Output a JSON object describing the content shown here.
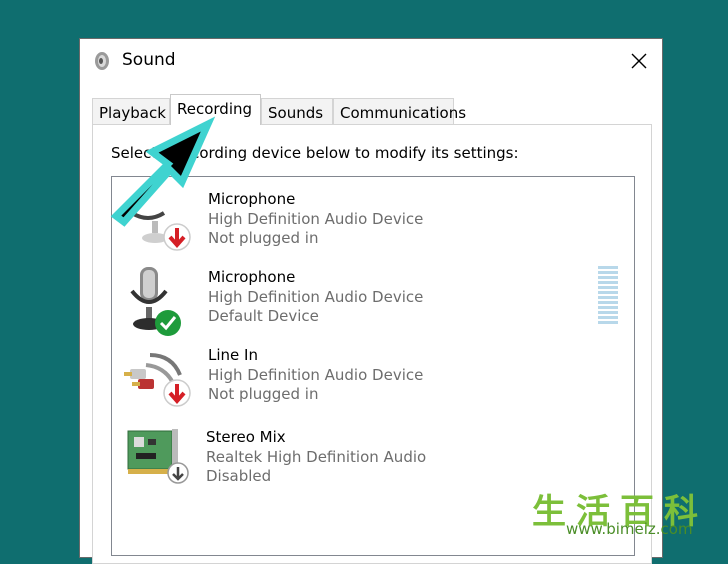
{
  "window": {
    "title": "Sound"
  },
  "tabs": [
    {
      "label": "Playback",
      "active": false
    },
    {
      "label": "Recording",
      "active": true
    },
    {
      "label": "Sounds",
      "active": false
    },
    {
      "label": "Communications",
      "active": false
    }
  ],
  "instructions": "Select a recording device below to modify its settings:",
  "devices": [
    {
      "name": "Microphone",
      "driver": "High Definition Audio Device",
      "status": "Not plugged in",
      "icon": "microphone-icon",
      "badge": "red-down-arrow-icon"
    },
    {
      "name": "Microphone",
      "driver": "High Definition Audio Device",
      "status": "Default Device",
      "icon": "microphone-icon",
      "badge": "green-check-icon"
    },
    {
      "name": "Line In",
      "driver": "High Definition Audio Device",
      "status": "Not plugged in",
      "icon": "rca-cable-icon",
      "badge": "red-down-arrow-icon"
    },
    {
      "name": "Stereo Mix",
      "driver": "Realtek High Definition Audio",
      "status": "Disabled",
      "icon": "sound-card-icon",
      "badge": "gray-down-arrow-icon"
    }
  ],
  "watermark": {
    "logo": "生活百科",
    "url": "www.bimeiz.com"
  },
  "colors": {
    "desktop": "#0f6e6f",
    "pointer_outline": "#3fd3d0",
    "check_green": "#1e9b3b",
    "arrow_red": "#d51f26"
  }
}
